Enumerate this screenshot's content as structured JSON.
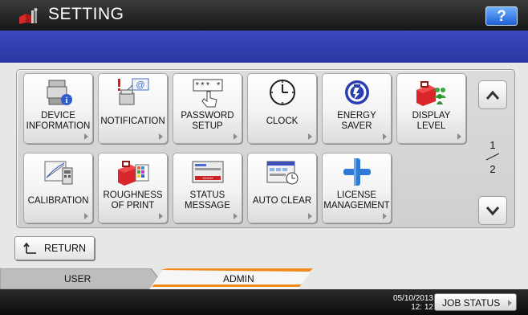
{
  "header": {
    "title": "SETTING",
    "help_label": "?",
    "icon": "toolbox-setting-icon"
  },
  "buttons": {
    "device_information": {
      "line1": "DEVICE",
      "line2": "INFORMATION",
      "icon": "device-info-icon"
    },
    "notification": {
      "line1": "NOTIFICATION",
      "icon": "notification-email-icon"
    },
    "password_setup": {
      "line1": "PASSWORD",
      "line2": "SETUP",
      "icon": "password-keypad-icon"
    },
    "clock": {
      "line1": "CLOCK",
      "icon": "clock-icon"
    },
    "energy_saver": {
      "line1": "ENERGY",
      "line2": "SAVER",
      "icon": "energy-saver-icon"
    },
    "display_level": {
      "line1": "DISPLAY",
      "line2": "LEVEL",
      "icon": "display-level-toolbox-users-icon"
    },
    "calibration": {
      "line1": "CALIBRATION",
      "icon": "calibration-icon"
    },
    "roughness_of_print": {
      "line1": "ROUGHNESS",
      "line2": "OF PRINT",
      "icon": "roughness-toolbox-icon"
    },
    "status_message": {
      "line1": "STATUS",
      "line2": "MESSAGE",
      "icon": "status-message-icon"
    },
    "auto_clear": {
      "line1": "AUTO CLEAR",
      "icon": "auto-clear-icon"
    },
    "license_management": {
      "line1": "LICENSE",
      "line2": "MANAGEMENT",
      "icon": "license-plus-icon"
    }
  },
  "pagination": {
    "current": "1",
    "total": "2"
  },
  "return_label": "RETURN",
  "tabs": {
    "user": "USER",
    "admin": "ADMIN",
    "active": "admin"
  },
  "status": {
    "date": "05/10/2013",
    "time": "12: 12",
    "job_status_label": "JOB STATUS"
  },
  "colors": {
    "header_blue": "#2f3db0",
    "admin_tab_accent": "#f08a1c",
    "help_blue": "#2b6fe0"
  }
}
